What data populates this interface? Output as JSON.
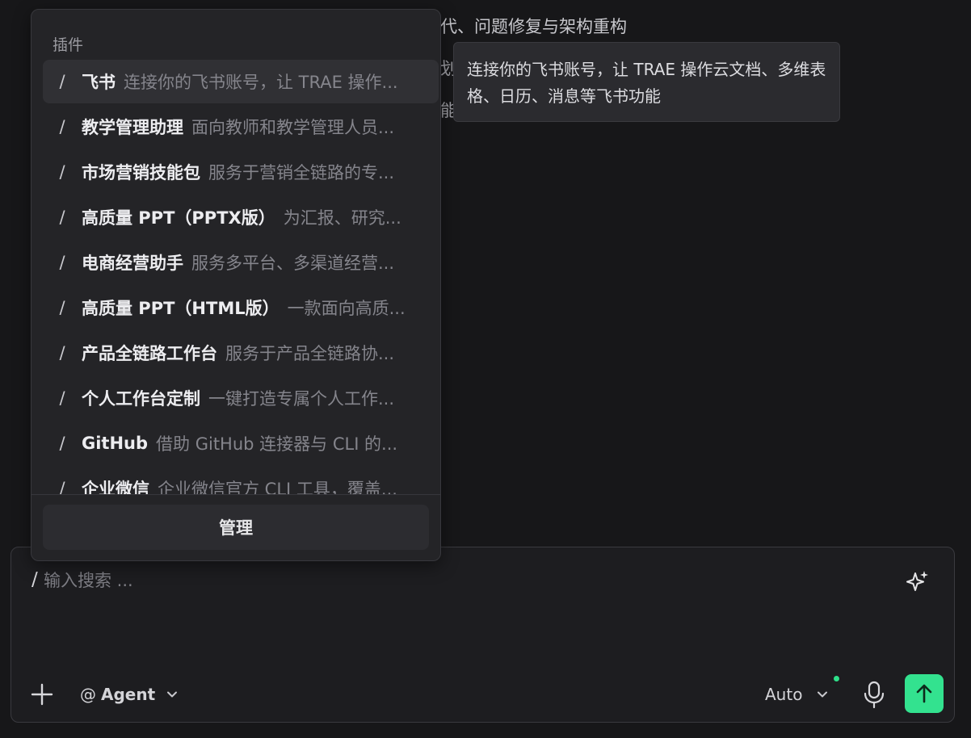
{
  "background": {
    "line1": "代、问题修复与架构重构",
    "line2": "划",
    "line3": "能"
  },
  "plugins_menu": {
    "header": "插件",
    "items": [
      {
        "slash": "/",
        "name": "飞书",
        "desc": "连接你的飞书账号，让 TRAE 操作..."
      },
      {
        "slash": "/",
        "name": "教学管理助理",
        "desc": "面向教师和教学管理人员..."
      },
      {
        "slash": "/",
        "name": "市场营销技能包",
        "desc": "服务于营销全链路的专..."
      },
      {
        "slash": "/",
        "name": "高质量 PPT（PPTX版）",
        "desc": "为汇报、研究..."
      },
      {
        "slash": "/",
        "name": "电商经营助手",
        "desc": "服务多平台、多渠道经营..."
      },
      {
        "slash": "/",
        "name": "高质量 PPT（HTML版）",
        "desc": "一款面向高质..."
      },
      {
        "slash": "/",
        "name": "产品全链路工作台",
        "desc": "服务于产品全链路协..."
      },
      {
        "slash": "/",
        "name": "个人工作台定制",
        "desc": "一键打造专属个人工作..."
      },
      {
        "slash": "/",
        "name": "GitHub",
        "desc": "借助 GitHub 连接器与 CLI 的..."
      },
      {
        "slash": "/",
        "name": "企业微信",
        "desc": "企业微信官方 CLI 工具，覆盖..."
      }
    ],
    "manage_label": "管理"
  },
  "tooltip": {
    "text": "连接你的飞书账号，让 TRAE 操作云文档、多维表格、日历、消息等飞书功能"
  },
  "composer": {
    "slash": "/",
    "placeholder": "输入搜索 ...",
    "agent_at": "@",
    "agent_label": "Agent",
    "model_label": "Auto"
  },
  "colors": {
    "send_button": "#33e28f",
    "status_dot": "#2ee08a",
    "background": "#171719"
  }
}
